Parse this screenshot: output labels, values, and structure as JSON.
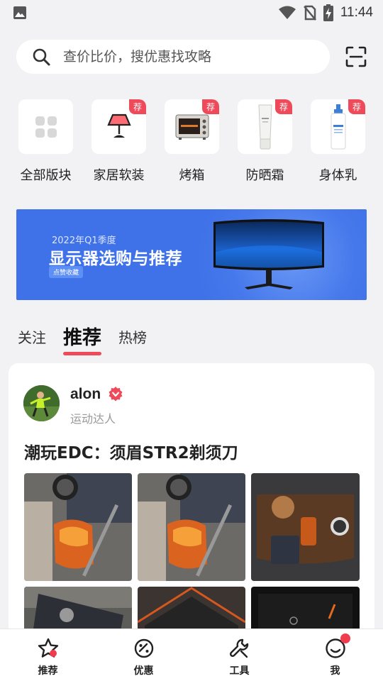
{
  "status_bar": {
    "time": "11:44"
  },
  "search": {
    "placeholder": "查价比价，搜优惠找攻略"
  },
  "categories": [
    {
      "label": "全部版块",
      "badge": "",
      "icon": "grid-icon"
    },
    {
      "label": "家居软装",
      "badge": "荐",
      "icon": "lamp-icon"
    },
    {
      "label": "烤箱",
      "badge": "荐",
      "icon": "oven-icon"
    },
    {
      "label": "防晒霜",
      "badge": "荐",
      "icon": "sunscreen-icon"
    },
    {
      "label": "身体乳",
      "badge": "荐",
      "icon": "body-lotion-icon"
    }
  ],
  "banner": {
    "year": "2022年Q1季度",
    "title": "显示器选购与推荐",
    "pill": "点赞收藏"
  },
  "feed_tabs": [
    "关注",
    "推荐",
    "热榜"
  ],
  "feed_active_tab": "推荐",
  "post": {
    "author": "alon",
    "author_title": "运动达人",
    "title": "潮玩EDC：须眉STR2剃须刀"
  },
  "bottom_nav": [
    {
      "label": "推荐",
      "icon": "star-icon"
    },
    {
      "label": "优惠",
      "icon": "coupon-icon"
    },
    {
      "label": "工具",
      "icon": "wrench-icon"
    },
    {
      "label": "我",
      "icon": "smile-icon"
    }
  ],
  "colors": {
    "accent": "#ef4a5a",
    "banner": "#3f72e8",
    "background": "#f2f2f4"
  }
}
